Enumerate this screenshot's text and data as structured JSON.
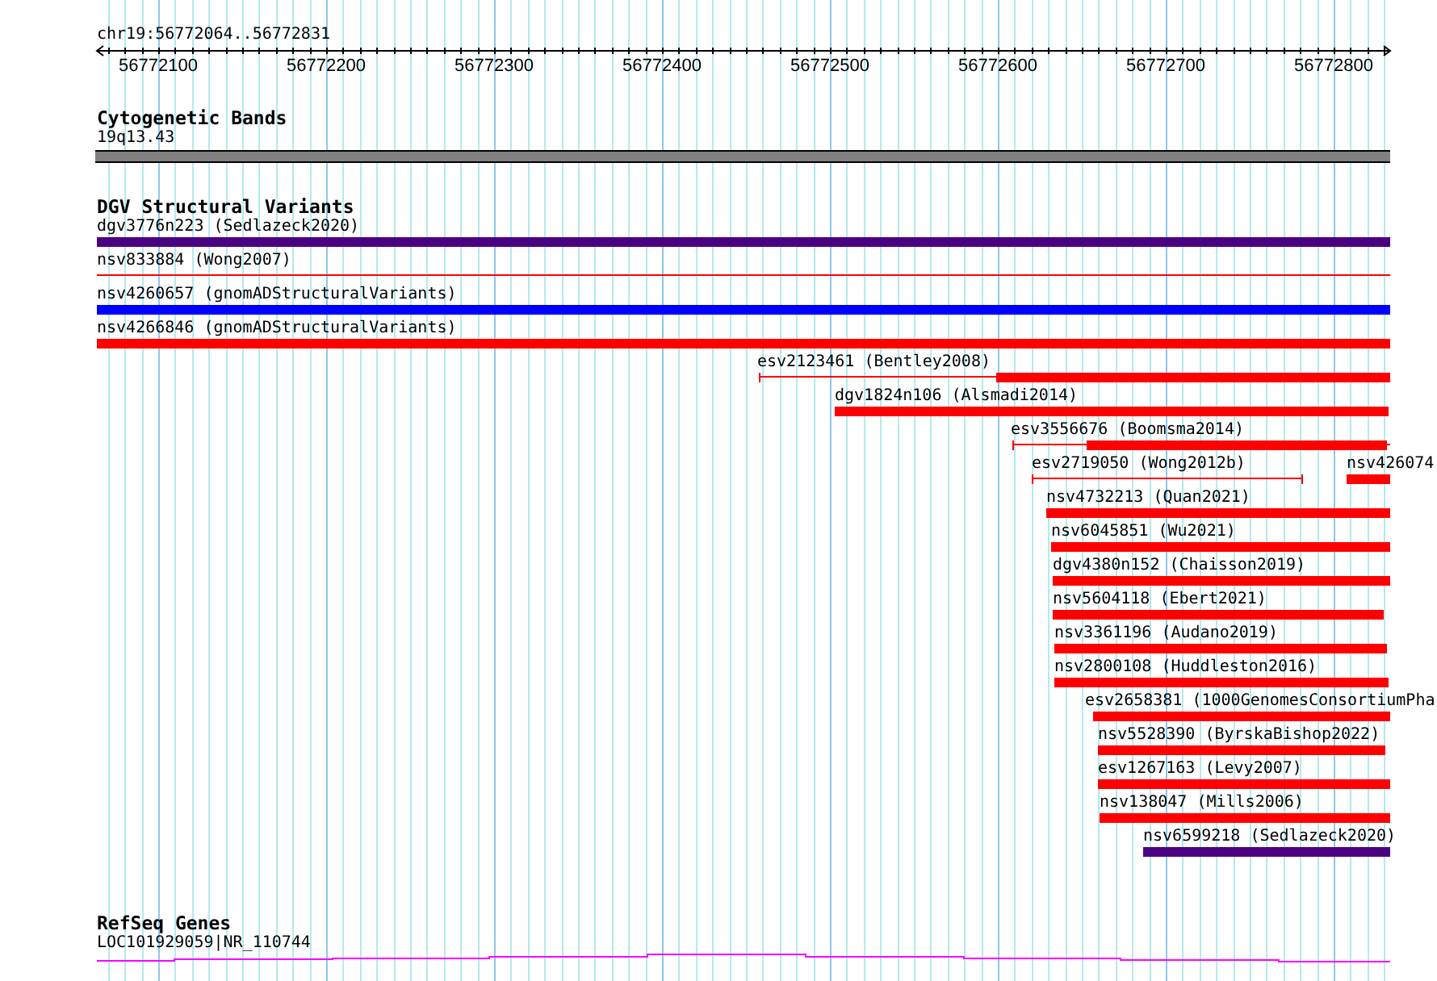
{
  "ruler": {
    "location": "chr19:56772064..56772831",
    "ticks": [
      "56772100",
      "56772200",
      "56772300",
      "56772400",
      "56772500",
      "56772600",
      "56772700",
      "56772800"
    ]
  },
  "tracks": [
    {
      "kind": "bands",
      "title": "Cytogenetic Bands",
      "bands": [
        {
          "label": "19q13.43"
        }
      ]
    },
    {
      "kind": "variants",
      "title": "DGV Structural Variants",
      "rows": [
        {
          "features": [
            {
              "kind": "bar",
              "label": "dgv3776n223 (Sedlazeck2020)",
              "color": "#4b0082"
            }
          ]
        },
        {
          "features": [
            {
              "kind": "line",
              "label": "nsv833884 (Wong2007)",
              "color": "#ff0000"
            }
          ]
        },
        {
          "features": [
            {
              "kind": "bar",
              "label": "nsv4260657 (gnomADStructuralVariants)",
              "color": "#0000ff"
            }
          ]
        },
        {
          "features": [
            {
              "kind": "bar",
              "label": "nsv4266846 (gnomADStructuralVariants)",
              "color": "#ff0000"
            }
          ]
        },
        {
          "features": [
            {
              "kind": "whisker",
              "label": "esv2123461 (Bentley2008)",
              "color": "#ff0000"
            }
          ]
        },
        {
          "features": [
            {
              "kind": "bar",
              "label": "dgv1824n106 (Alsmadi2014)",
              "color": "#ff0000"
            }
          ]
        },
        {
          "features": [
            {
              "kind": "whisker",
              "label": "esv3556676 (Boomsma2014)",
              "color": "#ff0000"
            }
          ]
        },
        {
          "features": [
            {
              "kind": "span",
              "label": "esv2719050 (Wong2012b)",
              "color": "#ff0000"
            },
            {
              "kind": "bar",
              "label": "nsv426074",
              "color": "#ff0000"
            }
          ]
        },
        {
          "features": [
            {
              "kind": "bar",
              "label": "nsv4732213 (Quan2021)",
              "color": "#ff0000"
            }
          ]
        },
        {
          "features": [
            {
              "kind": "bar",
              "label": "nsv6045851 (Wu2021)",
              "color": "#ff0000"
            }
          ]
        },
        {
          "features": [
            {
              "kind": "bar",
              "label": "dgv4380n152 (Chaisson2019)",
              "color": "#ff0000"
            }
          ]
        },
        {
          "features": [
            {
              "kind": "bar",
              "label": "nsv5604118 (Ebert2021)",
              "color": "#ff0000"
            }
          ]
        },
        {
          "features": [
            {
              "kind": "bar",
              "label": "nsv3361196 (Audano2019)",
              "color": "#ff0000"
            }
          ]
        },
        {
          "features": [
            {
              "kind": "bar",
              "label": "nsv2800108 (Huddleston2016)",
              "color": "#ff0000"
            }
          ]
        },
        {
          "features": [
            {
              "kind": "bar",
              "label": "esv2658381 (1000GenomesConsortiumPha",
              "color": "#ff0000"
            }
          ]
        },
        {
          "features": [
            {
              "kind": "bar",
              "label": "nsv5528390 (ByrskaBishop2022)",
              "color": "#ff0000"
            }
          ]
        },
        {
          "features": [
            {
              "kind": "bar",
              "label": "esv1267163 (Levy2007)",
              "color": "#ff0000"
            }
          ]
        },
        {
          "features": [
            {
              "kind": "bar",
              "label": "nsv138047 (Mills2006)",
              "color": "#ff0000"
            }
          ]
        },
        {
          "features": [
            {
              "kind": "bar",
              "label": "nsv6599218 (Sedlazeck2020)",
              "color": "#4b0082"
            }
          ]
        }
      ]
    },
    {
      "kind": "genes",
      "title": "RefSeq Genes",
      "genes": [
        {
          "label": "LOC101929059|NR_110744"
        }
      ]
    }
  ]
}
